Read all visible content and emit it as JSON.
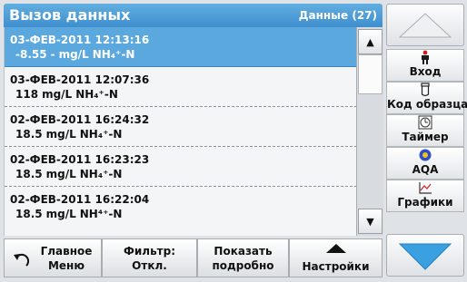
{
  "header": {
    "title": "Вызов данных",
    "count": "Данные (27)"
  },
  "records": [
    {
      "date": "03-ФЕВ-2011",
      "time": "12:13:16",
      "value": "-8.55",
      "sep": "-",
      "unit": "mg/L",
      "param": "NH₄⁺-N",
      "selected": true
    },
    {
      "date": "03-ФЕВ-2011",
      "time": "12:07:36",
      "value": "118",
      "sep": "",
      "unit": "mg/L",
      "param": "NH₄⁺-N",
      "selected": false
    },
    {
      "date": "02-ФЕВ-2011",
      "time": "16:24:32",
      "value": "18.5",
      "sep": "",
      "unit": "mg/L",
      "param": "NH₄⁺-N",
      "selected": false
    },
    {
      "date": "02-ФЕВ-2011",
      "time": "16:23:23",
      "value": "18.5",
      "sep": "",
      "unit": "mg/L",
      "param": "NH₄⁺-N",
      "selected": false
    },
    {
      "date": "02-ФЕВ-2011",
      "time": "16:22:04",
      "value": "18.5",
      "sep": "",
      "unit": "mg/L",
      "param": "NH⁴⁺-N",
      "selected": false
    }
  ],
  "sidebar": [
    {
      "label": "Вход",
      "icon": "person-icon"
    },
    {
      "label": "Код образца",
      "icon": "sample-vial-icon"
    },
    {
      "label": "Таймер",
      "icon": "timer-icon"
    },
    {
      "label": "AQA",
      "icon": "aqa-icon"
    },
    {
      "label": "Графики",
      "icon": "graph-icon"
    }
  ],
  "toolbar": {
    "home_line1": "Главное",
    "home_line2": "Меню",
    "filter_line1": "Фильтр:",
    "filter_line2": "Откл.",
    "details_line1": "Показать",
    "details_line2": "подробно",
    "settings": "Настройки"
  },
  "colors": {
    "accent": "#4a9ad6",
    "selection": "#5aa8de"
  }
}
